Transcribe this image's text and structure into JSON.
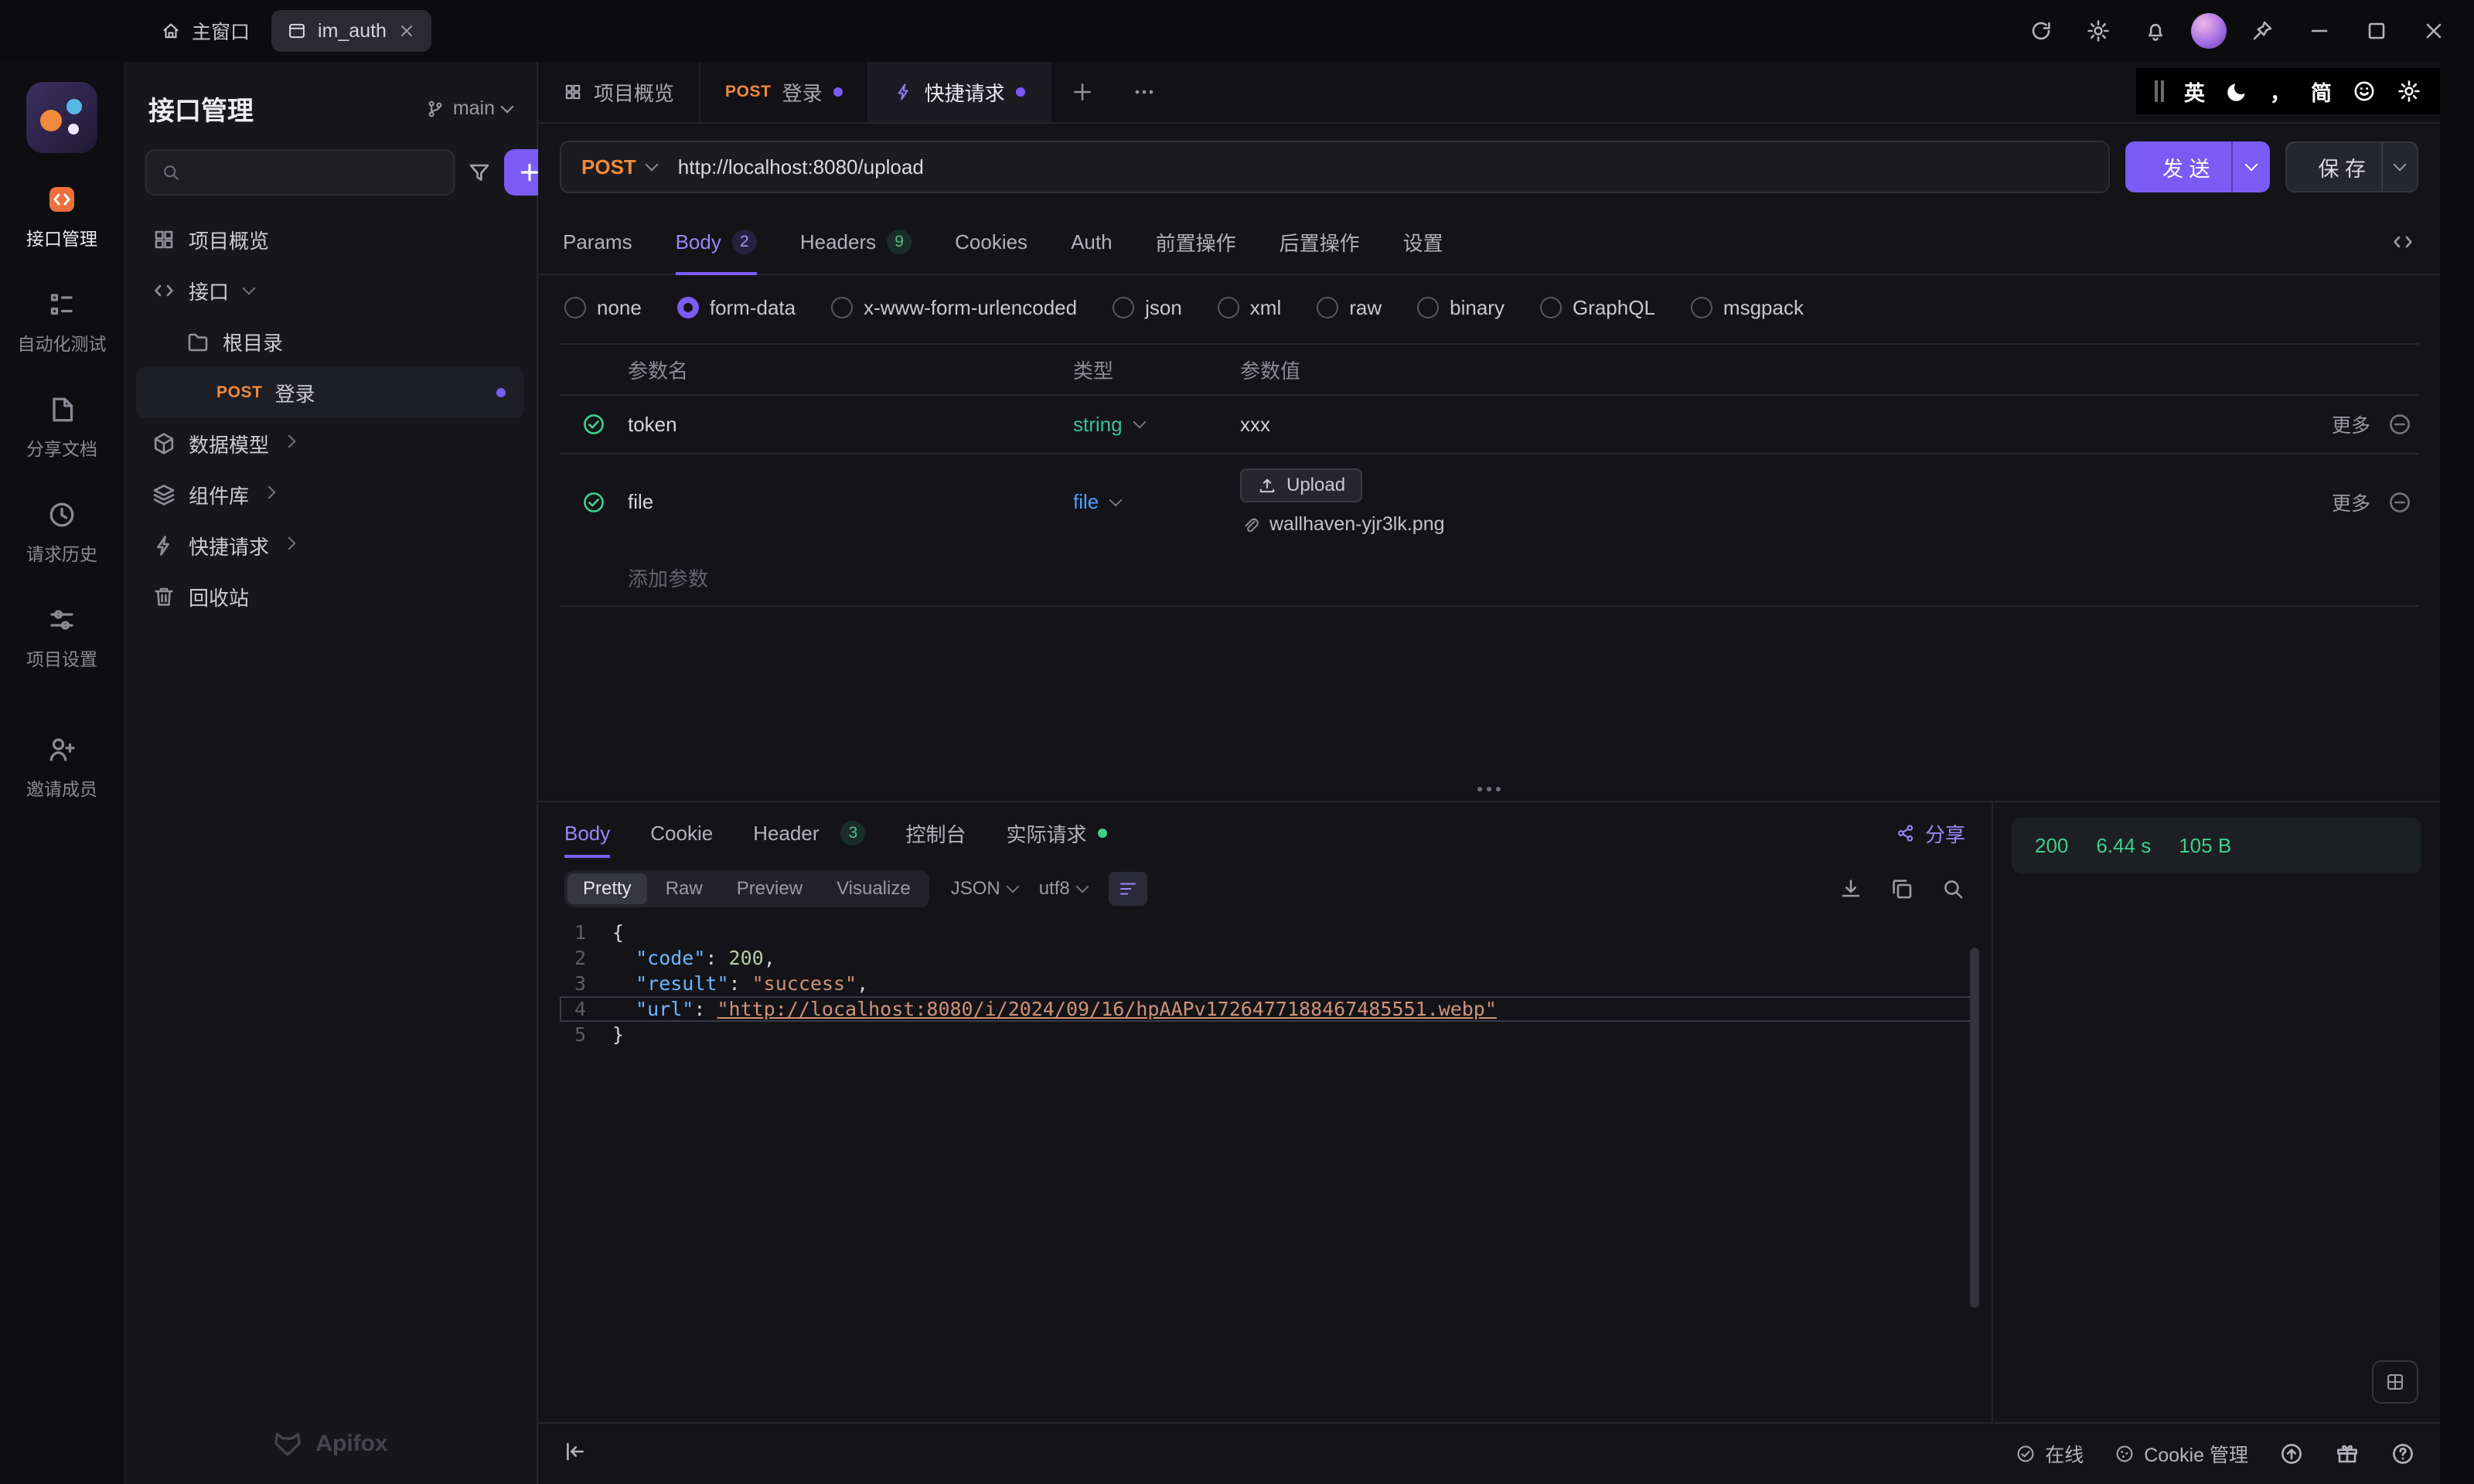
{
  "colors": {
    "accent": "#7a5cf5",
    "method_post": "#ef8a3c",
    "success_green": "#3ecf8e",
    "type_string": "#3bbf9a",
    "type_file": "#4c9fff"
  },
  "titlebar": {
    "home": "主窗口",
    "tab": "im_auth"
  },
  "ime": {
    "en": "英",
    "punct": "，",
    "lang": "简"
  },
  "iconrail": {
    "items": [
      {
        "label": "接口管理"
      },
      {
        "label": "自动化测试"
      },
      {
        "label": "分享文档"
      },
      {
        "label": "请求历史"
      },
      {
        "label": "项目设置"
      },
      {
        "label": "邀请成员"
      }
    ]
  },
  "sidebar": {
    "title": "接口管理",
    "branch": "main",
    "overview": "项目概览",
    "api_group": "接口",
    "root_dir": "根目录",
    "login_method": "POST",
    "login": "登录",
    "models": "数据模型",
    "components": "组件库",
    "quick": "快捷请求",
    "trash": "回收站",
    "brand": "Apifox"
  },
  "doctabs": {
    "overview": "项目概览",
    "login_method": "POST",
    "login": "登录",
    "quick": "快捷请求"
  },
  "request": {
    "method": "POST",
    "url": "http://localhost:8080/upload",
    "send": "发 送",
    "save": "保 存"
  },
  "reqtabs": {
    "params": "Params",
    "body": "Body",
    "body_badge": "2",
    "headers": "Headers",
    "headers_badge": "9",
    "cookies": "Cookies",
    "auth": "Auth",
    "pre_ops": "前置操作",
    "post_ops": "后置操作",
    "settings": "设置"
  },
  "bodytypes": {
    "options": [
      "none",
      "form-data",
      "x-www-form-urlencoded",
      "json",
      "xml",
      "raw",
      "binary",
      "GraphQL",
      "msgpack"
    ],
    "selected": "form-data"
  },
  "ptable": {
    "col_name": "参数名",
    "col_type": "类型",
    "col_value": "参数值",
    "rows": [
      {
        "name": "token",
        "type": "string",
        "value": "xxx",
        "more": "更多"
      },
      {
        "name": "file",
        "type": "file",
        "upload": "Upload",
        "filename": "wallhaven-yjr3lk.png",
        "more": "更多"
      }
    ],
    "add": "添加参数"
  },
  "response": {
    "tab_body": "Body",
    "tab_cookie": "Cookie",
    "tab_header": "Header",
    "header_badge": "3",
    "tab_console": "控制台",
    "tab_actual": "实际请求",
    "share": "分享",
    "status_code": "200",
    "time": "6.44 s",
    "size": "105 B",
    "views": [
      "Pretty",
      "Raw",
      "Preview",
      "Visualize"
    ],
    "format": "JSON",
    "encoding": "utf8",
    "code": {
      "lines": [
        {
          "n": "1",
          "plain": "{"
        },
        {
          "n": "2",
          "key": "  \"code\"",
          "sep": ": ",
          "num": "200",
          "end": ","
        },
        {
          "n": "3",
          "key": "  \"result\"",
          "sep": ": ",
          "str": "\"success\"",
          "end": ","
        },
        {
          "n": "4",
          "key": "  \"url\"",
          "sep": ": ",
          "link": "\"http://localhost:8080/i/2024/09/16/hpAAPv1726477188467485551.webp\""
        },
        {
          "n": "5",
          "plain": "}"
        }
      ]
    }
  },
  "statusbar": {
    "online": "在线",
    "cookie": "Cookie 管理"
  }
}
